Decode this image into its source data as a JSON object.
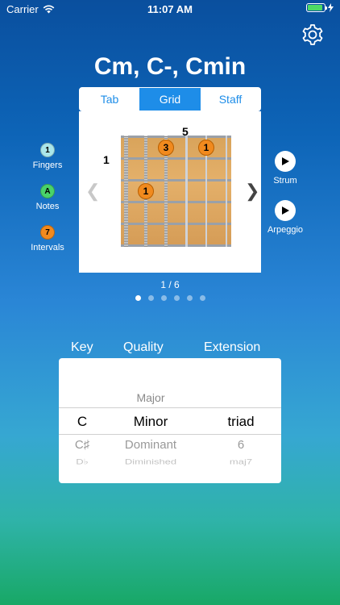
{
  "status": {
    "carrier": "Carrier",
    "time": "11:07 AM",
    "battery_level": 0.9
  },
  "chord": {
    "title": "Cm, C-, Cmin"
  },
  "tabs": [
    {
      "label": "Tab",
      "active": false
    },
    {
      "label": "Grid",
      "active": true
    },
    {
      "label": "Staff",
      "active": false
    }
  ],
  "diagram": {
    "start_fret_label": "1",
    "top_fret_label": "5",
    "markers": [
      {
        "label": "3",
        "string": 2,
        "fret": 1
      },
      {
        "label": "1",
        "string": 4,
        "fret": 1
      },
      {
        "label": "1",
        "string": 1,
        "fret": 3
      }
    ],
    "prev_arrow": "❮",
    "next_arrow": "❯"
  },
  "left_controls": [
    {
      "badge": "1",
      "label": "Fingers",
      "color": "#a9e6ea"
    },
    {
      "badge": "A",
      "label": "Notes",
      "color": "#49d36a"
    },
    {
      "badge": "7",
      "label": "Intervals",
      "color": "#f18a1e"
    }
  ],
  "right_controls": [
    {
      "label": "Strum"
    },
    {
      "label": "Arpeggio"
    }
  ],
  "pager": {
    "text": "1 / 6",
    "total": 6,
    "active": 0
  },
  "picker": {
    "headers": {
      "key": "Key",
      "quality": "Quality",
      "extension": "Extension"
    },
    "rows": [
      {
        "key": "",
        "quality": "Major",
        "extension": ""
      },
      {
        "key": "C",
        "quality": "Minor",
        "extension": "triad"
      },
      {
        "key": "C♯",
        "quality": "Dominant",
        "extension": "6"
      },
      {
        "key": "D♭",
        "quality": "Diminished",
        "extension": "maj7"
      }
    ]
  }
}
